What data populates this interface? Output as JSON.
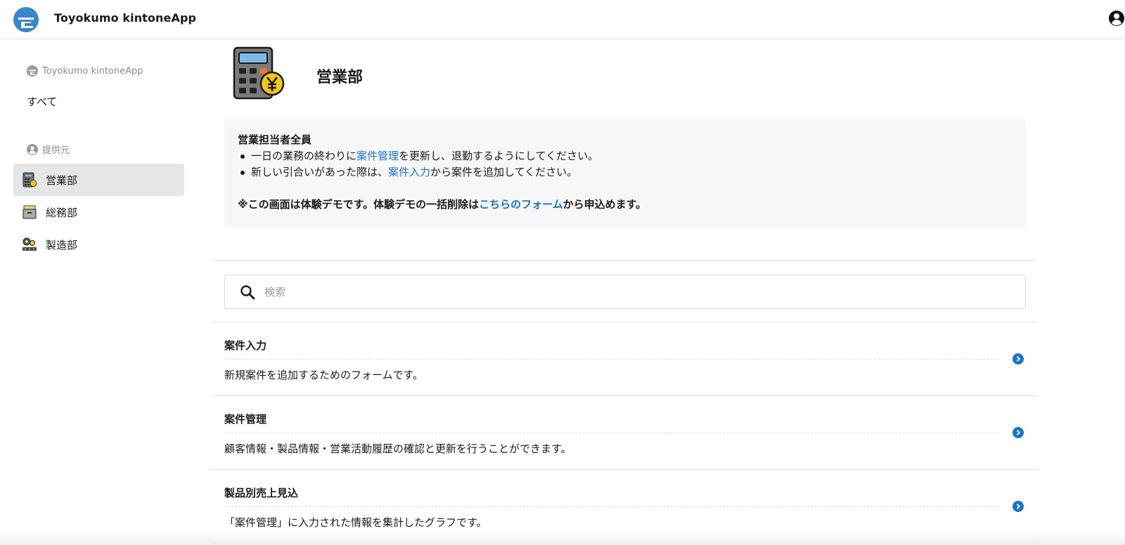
{
  "header": {
    "brand_name": "Toyokumo kintoneApp",
    "brand_color": "#3a86c8"
  },
  "sidebar": {
    "group_brand_label": "Toyokumo kintoneApp",
    "all_label": "すべて",
    "provider_label": "提供元",
    "items": [
      {
        "label": "営業部",
        "icon": "calculator-icon",
        "active": true
      },
      {
        "label": "総務部",
        "icon": "drawer-icon",
        "active": false
      },
      {
        "label": "製造部",
        "icon": "factory-gears-icon",
        "active": false
      }
    ]
  },
  "main": {
    "title": "営業部",
    "notice": {
      "heading": "営業担当者全員",
      "line1_before": "一日の業務の終わりに",
      "line1_link": "案件管理",
      "line1_after": "を更新し、退勤するようにしてください。",
      "line2_before": "新しい引合いがあった際は、",
      "line2_link": "案件入力",
      "line2_after": "から案件を追加してください。",
      "note_before": "※この画面は体験デモです。体験デモの一括削除は",
      "note_link": "こちらのフォーム",
      "note_after": "から申込めます。"
    },
    "search": {
      "placeholder": "検索",
      "value": ""
    },
    "apps": [
      {
        "title": "案件入力",
        "description": "新規案件を追加するためのフォームです。"
      },
      {
        "title": "案件管理",
        "description": "顧客情報・製品情報・営業活動履歴の確認と更新を行うことができます。"
      },
      {
        "title": "製品別売上見込",
        "description": "「案件管理」に入力された情報を集計したグラフです。"
      }
    ]
  },
  "colors": {
    "link": "#1a73c8",
    "active_bg": "#e6e6e6",
    "notice_bg": "#f7f7f7"
  }
}
